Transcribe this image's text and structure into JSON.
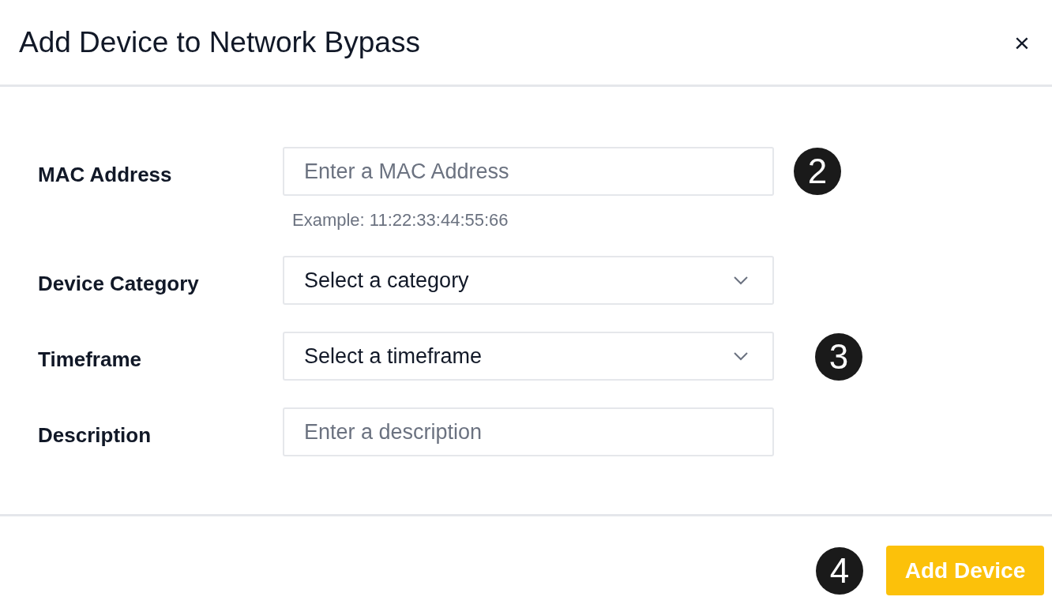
{
  "dialog": {
    "title": "Add Device to Network Bypass",
    "close": "×"
  },
  "fields": [
    {
      "label": "MAC Address",
      "kind": "input",
      "placeholder": "Enter a MAC Address",
      "hint": "Example: 11:22:33:44:55:66",
      "callout": "2"
    },
    {
      "label": "Device Category",
      "kind": "select",
      "value": "Select a category"
    },
    {
      "label": "Timeframe",
      "kind": "select",
      "value": "Select a timeframe",
      "callout": "3"
    },
    {
      "label": "Description",
      "kind": "input",
      "placeholder": "Enter a description"
    }
  ],
  "footer": {
    "callout": "4",
    "button": "Add Device"
  }
}
